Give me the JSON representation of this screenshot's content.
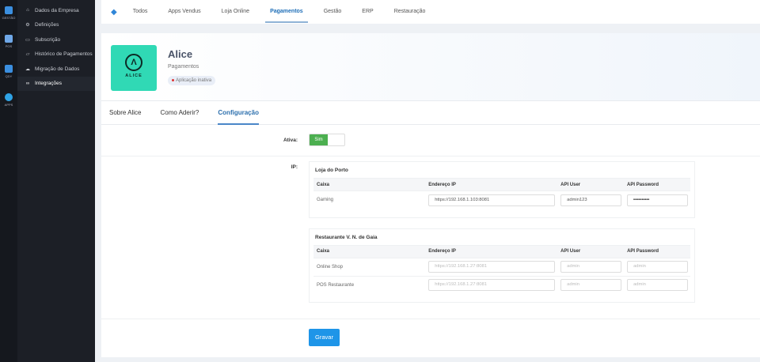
{
  "rail": [
    {
      "label": "GESTÃO"
    },
    {
      "label": "POS"
    },
    {
      "label": "QDY"
    },
    {
      "label": "APPS"
    }
  ],
  "sidebar": [
    {
      "icon": "⌂",
      "label": "Dados da Empresa"
    },
    {
      "icon": "⚙",
      "label": "Definições"
    },
    {
      "icon": "▭",
      "label": "Subscrição"
    },
    {
      "icon": "▱",
      "label": "Histórico de Pagamentos"
    },
    {
      "icon": "☁",
      "label": "Migração de Dados"
    },
    {
      "icon": "∞",
      "label": "Integrações"
    }
  ],
  "topnav": [
    "Todos",
    "Apps Vendus",
    "Loja Online",
    "Pagamentos",
    "Gestão",
    "ERP",
    "Restauração"
  ],
  "app": {
    "name": "Alice",
    "logo_text": "ALICE",
    "category": "Pagamentos",
    "status": "Aplicação inativa"
  },
  "tabs": [
    "Sobre Alice",
    "Como Aderir?",
    "Configuração"
  ],
  "config": {
    "active_label": "Ativa:",
    "toggle": "Sim",
    "ip_label": "IP:",
    "save": "Gravar"
  },
  "columns": [
    "Caixa",
    "Endereço IP",
    "API User",
    "API Password"
  ],
  "groups": [
    {
      "name": "Loja do Porto",
      "rows": [
        {
          "caixa": "Gaming",
          "ip": "https://192.168.1.103:8081",
          "user": "admin123",
          "password": "••••••••••",
          "filled": true
        }
      ]
    },
    {
      "name": "Restaurante V. N. de Gaia",
      "rows": [
        {
          "caixa": "Online Shop",
          "ip": "https://192.168.1.27:8081",
          "user": "admin",
          "password": "admin",
          "filled": false
        },
        {
          "caixa": "POS Restaurante",
          "ip": "https://192.168.1.27:8081",
          "user": "admin",
          "password": "admin",
          "filled": false
        }
      ]
    }
  ]
}
